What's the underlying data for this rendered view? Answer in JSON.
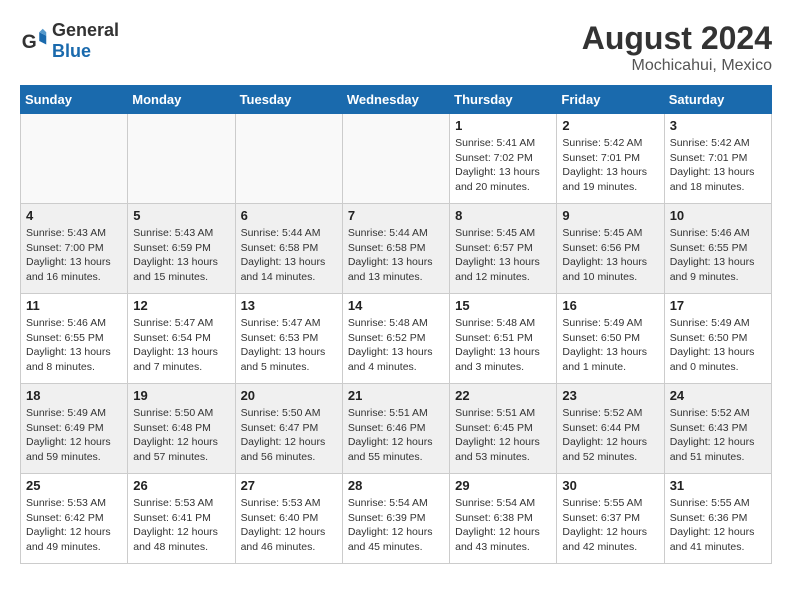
{
  "header": {
    "logo_general": "General",
    "logo_blue": "Blue",
    "month_year": "August 2024",
    "location": "Mochicahui, Mexico"
  },
  "weekdays": [
    "Sunday",
    "Monday",
    "Tuesday",
    "Wednesday",
    "Thursday",
    "Friday",
    "Saturday"
  ],
  "weeks": [
    [
      {
        "day": "",
        "empty": true
      },
      {
        "day": "",
        "empty": true
      },
      {
        "day": "",
        "empty": true
      },
      {
        "day": "",
        "empty": true
      },
      {
        "day": "1",
        "line1": "Sunrise: 5:41 AM",
        "line2": "Sunset: 7:02 PM",
        "line3": "Daylight: 13 hours",
        "line4": "and 20 minutes."
      },
      {
        "day": "2",
        "line1": "Sunrise: 5:42 AM",
        "line2": "Sunset: 7:01 PM",
        "line3": "Daylight: 13 hours",
        "line4": "and 19 minutes."
      },
      {
        "day": "3",
        "line1": "Sunrise: 5:42 AM",
        "line2": "Sunset: 7:01 PM",
        "line3": "Daylight: 13 hours",
        "line4": "and 18 minutes."
      }
    ],
    [
      {
        "day": "4",
        "line1": "Sunrise: 5:43 AM",
        "line2": "Sunset: 7:00 PM",
        "line3": "Daylight: 13 hours",
        "line4": "and 16 minutes."
      },
      {
        "day": "5",
        "line1": "Sunrise: 5:43 AM",
        "line2": "Sunset: 6:59 PM",
        "line3": "Daylight: 13 hours",
        "line4": "and 15 minutes."
      },
      {
        "day": "6",
        "line1": "Sunrise: 5:44 AM",
        "line2": "Sunset: 6:58 PM",
        "line3": "Daylight: 13 hours",
        "line4": "and 14 minutes."
      },
      {
        "day": "7",
        "line1": "Sunrise: 5:44 AM",
        "line2": "Sunset: 6:58 PM",
        "line3": "Daylight: 13 hours",
        "line4": "and 13 minutes."
      },
      {
        "day": "8",
        "line1": "Sunrise: 5:45 AM",
        "line2": "Sunset: 6:57 PM",
        "line3": "Daylight: 13 hours",
        "line4": "and 12 minutes."
      },
      {
        "day": "9",
        "line1": "Sunrise: 5:45 AM",
        "line2": "Sunset: 6:56 PM",
        "line3": "Daylight: 13 hours",
        "line4": "and 10 minutes."
      },
      {
        "day": "10",
        "line1": "Sunrise: 5:46 AM",
        "line2": "Sunset: 6:55 PM",
        "line3": "Daylight: 13 hours",
        "line4": "and 9 minutes."
      }
    ],
    [
      {
        "day": "11",
        "line1": "Sunrise: 5:46 AM",
        "line2": "Sunset: 6:55 PM",
        "line3": "Daylight: 13 hours",
        "line4": "and 8 minutes."
      },
      {
        "day": "12",
        "line1": "Sunrise: 5:47 AM",
        "line2": "Sunset: 6:54 PM",
        "line3": "Daylight: 13 hours",
        "line4": "and 7 minutes."
      },
      {
        "day": "13",
        "line1": "Sunrise: 5:47 AM",
        "line2": "Sunset: 6:53 PM",
        "line3": "Daylight: 13 hours",
        "line4": "and 5 minutes."
      },
      {
        "day": "14",
        "line1": "Sunrise: 5:48 AM",
        "line2": "Sunset: 6:52 PM",
        "line3": "Daylight: 13 hours",
        "line4": "and 4 minutes."
      },
      {
        "day": "15",
        "line1": "Sunrise: 5:48 AM",
        "line2": "Sunset: 6:51 PM",
        "line3": "Daylight: 13 hours",
        "line4": "and 3 minutes."
      },
      {
        "day": "16",
        "line1": "Sunrise: 5:49 AM",
        "line2": "Sunset: 6:50 PM",
        "line3": "Daylight: 13 hours",
        "line4": "and 1 minute."
      },
      {
        "day": "17",
        "line1": "Sunrise: 5:49 AM",
        "line2": "Sunset: 6:50 PM",
        "line3": "Daylight: 13 hours",
        "line4": "and 0 minutes."
      }
    ],
    [
      {
        "day": "18",
        "line1": "Sunrise: 5:49 AM",
        "line2": "Sunset: 6:49 PM",
        "line3": "Daylight: 12 hours",
        "line4": "and 59 minutes."
      },
      {
        "day": "19",
        "line1": "Sunrise: 5:50 AM",
        "line2": "Sunset: 6:48 PM",
        "line3": "Daylight: 12 hours",
        "line4": "and 57 minutes."
      },
      {
        "day": "20",
        "line1": "Sunrise: 5:50 AM",
        "line2": "Sunset: 6:47 PM",
        "line3": "Daylight: 12 hours",
        "line4": "and 56 minutes."
      },
      {
        "day": "21",
        "line1": "Sunrise: 5:51 AM",
        "line2": "Sunset: 6:46 PM",
        "line3": "Daylight: 12 hours",
        "line4": "and 55 minutes."
      },
      {
        "day": "22",
        "line1": "Sunrise: 5:51 AM",
        "line2": "Sunset: 6:45 PM",
        "line3": "Daylight: 12 hours",
        "line4": "and 53 minutes."
      },
      {
        "day": "23",
        "line1": "Sunrise: 5:52 AM",
        "line2": "Sunset: 6:44 PM",
        "line3": "Daylight: 12 hours",
        "line4": "and 52 minutes."
      },
      {
        "day": "24",
        "line1": "Sunrise: 5:52 AM",
        "line2": "Sunset: 6:43 PM",
        "line3": "Daylight: 12 hours",
        "line4": "and 51 minutes."
      }
    ],
    [
      {
        "day": "25",
        "line1": "Sunrise: 5:53 AM",
        "line2": "Sunset: 6:42 PM",
        "line3": "Daylight: 12 hours",
        "line4": "and 49 minutes."
      },
      {
        "day": "26",
        "line1": "Sunrise: 5:53 AM",
        "line2": "Sunset: 6:41 PM",
        "line3": "Daylight: 12 hours",
        "line4": "and 48 minutes."
      },
      {
        "day": "27",
        "line1": "Sunrise: 5:53 AM",
        "line2": "Sunset: 6:40 PM",
        "line3": "Daylight: 12 hours",
        "line4": "and 46 minutes."
      },
      {
        "day": "28",
        "line1": "Sunrise: 5:54 AM",
        "line2": "Sunset: 6:39 PM",
        "line3": "Daylight: 12 hours",
        "line4": "and 45 minutes."
      },
      {
        "day": "29",
        "line1": "Sunrise: 5:54 AM",
        "line2": "Sunset: 6:38 PM",
        "line3": "Daylight: 12 hours",
        "line4": "and 43 minutes."
      },
      {
        "day": "30",
        "line1": "Sunrise: 5:55 AM",
        "line2": "Sunset: 6:37 PM",
        "line3": "Daylight: 12 hours",
        "line4": "and 42 minutes."
      },
      {
        "day": "31",
        "line1": "Sunrise: 5:55 AM",
        "line2": "Sunset: 6:36 PM",
        "line3": "Daylight: 12 hours",
        "line4": "and 41 minutes."
      }
    ]
  ]
}
